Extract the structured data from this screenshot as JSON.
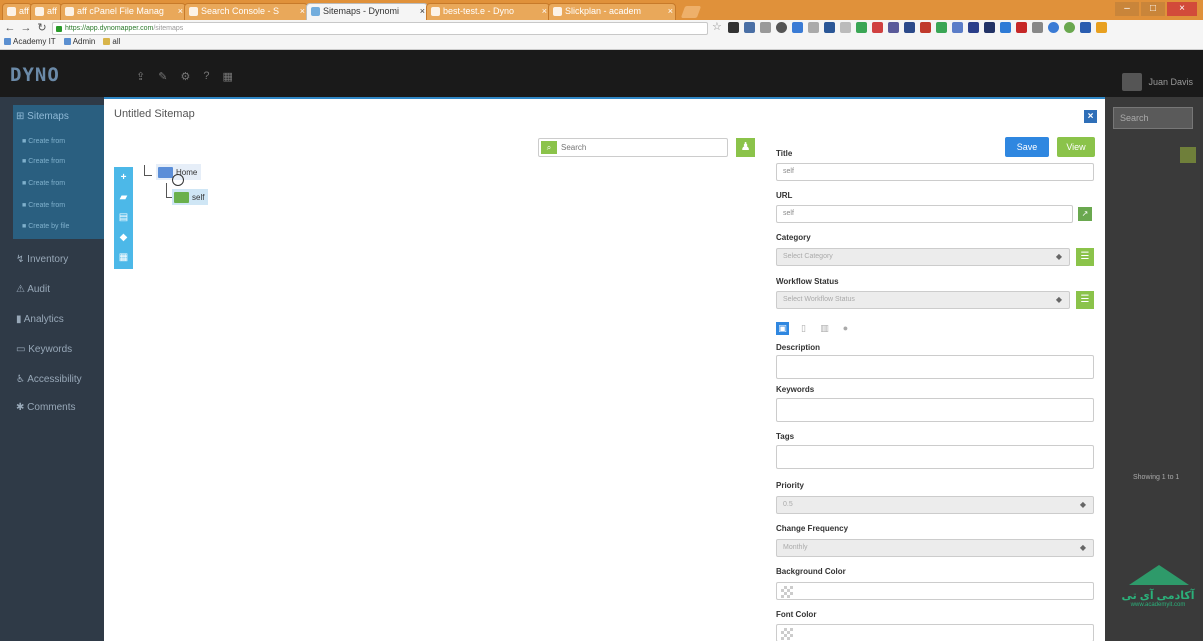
{
  "browser": {
    "tabs": [
      {
        "label": "aff"
      },
      {
        "label": "aff"
      },
      {
        "label": "aff cPanel File Manag"
      },
      {
        "label": "Search Console - S"
      },
      {
        "label": "Sitemaps - Dynomi"
      },
      {
        "label": "best-test.e - Dyno"
      },
      {
        "label": "Slickplan - academ"
      }
    ],
    "url_host": "https://app.dynomapper.com",
    "url_path": "/sitemaps",
    "bookmarks": [
      {
        "label": "Academy IT"
      },
      {
        "label": "Admin"
      },
      {
        "label": "all"
      }
    ],
    "window_controls": {
      "minimize": "–",
      "maximize": "□",
      "close": "×"
    }
  },
  "app": {
    "brand": "DYNO",
    "nav_icons": [
      "upload-icon",
      "edit-icon",
      "settings-icon",
      "help-icon",
      "grid-icon"
    ],
    "user_name": "Juan Davis"
  },
  "sidebar": {
    "sitemaps": "Sitemaps",
    "sub_items": [
      "Create from",
      "Create from",
      "Create from",
      "Create from",
      "Create by file"
    ],
    "inventory": "Inventory",
    "audit": "Audit",
    "analytics": "Analytics",
    "keywords": "Keywords",
    "accessibility": "Accessibility",
    "comments": "Comments"
  },
  "backdrop": {
    "search": "Search",
    "showing": "Showing 1 to 1"
  },
  "watermark": {
    "text": "آکادمی آی تی",
    "sub": "www.academyit.com"
  },
  "modal": {
    "title": "Untitled Sitemap",
    "close": "×",
    "tree": {
      "search_placeholder": "Search",
      "nodes": [
        {
          "label": "Home"
        },
        {
          "label": "self"
        }
      ]
    },
    "form": {
      "save": "Save",
      "view": "View",
      "title_label": "Title",
      "title_value": "self",
      "url_label": "URL",
      "url_value": "self",
      "category_label": "Category",
      "category_value": "Select Category",
      "workflow_label": "Workflow Status",
      "workflow_value": "Select Workflow Status",
      "description_label": "Description",
      "keywords_label": "Keywords",
      "tags_label": "Tags",
      "priority_label": "Priority",
      "priority_value": "0.5",
      "change_freq_label": "Change Frequency",
      "change_freq_value": "Monthly",
      "bg_color_label": "Background Color",
      "font_color_label": "Font Color"
    }
  },
  "colors": {
    "accent_blue": "#2f87e0",
    "accent_green": "#8bc34a",
    "sidebar_bg": "#2f3a47",
    "toolbar_cyan": "#4cb8e8"
  }
}
